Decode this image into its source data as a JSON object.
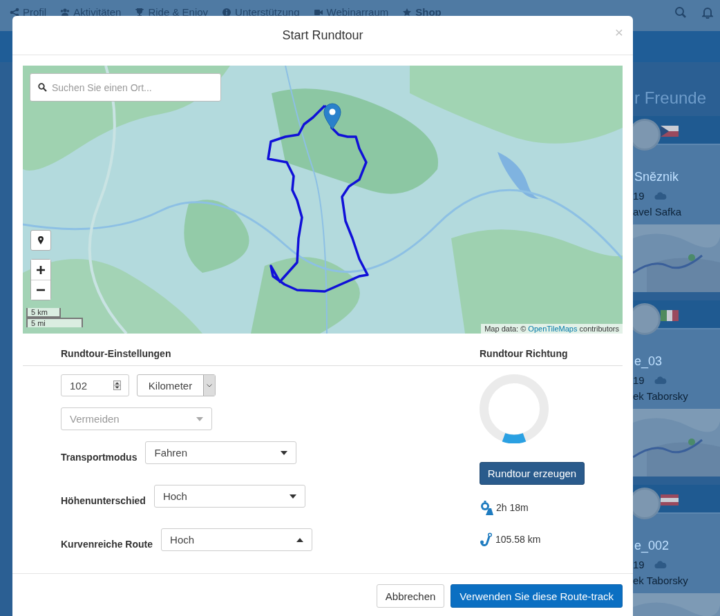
{
  "background_page": {
    "nav": [
      {
        "label": "Profil",
        "highlighted": false
      },
      {
        "label": "Aktivitäten",
        "highlighted": false
      },
      {
        "label": "Ride & Enjoy",
        "highlighted": false
      },
      {
        "label": "Unterstützung",
        "highlighted": false
      },
      {
        "label": "Webinarraum",
        "highlighted": false
      },
      {
        "label": "Shop",
        "highlighted": true
      }
    ],
    "friends_heading": "r Freunde",
    "friend_cards": [
      {
        "title": "Sněznik",
        "date": "19",
        "author": "avel Safka"
      },
      {
        "title": "e_03",
        "date": "19",
        "author": "ek Taborsky"
      },
      {
        "title": "e_002",
        "date": "19",
        "author": "ek Taborsky"
      }
    ]
  },
  "dialog": {
    "title": "Start Rundtour",
    "close": "×",
    "map": {
      "search_placeholder": "Suchen Sie einen Ort...",
      "scale": [
        "5 km",
        "5 mi"
      ],
      "attribution": {
        "prefix": "Map data: ©",
        "link": "OpenTileMaps",
        "suffix": "contributors"
      }
    },
    "settings": {
      "heading": "Rundtour-Einstellungen",
      "distance": "102",
      "unit": "Kilometer",
      "avoid_placeholder": "Vermeiden",
      "fields": [
        {
          "label": "Transportmodus",
          "value": "Fahren",
          "expanded": false
        },
        {
          "label": "Höhenunterschied",
          "value": "Hoch",
          "expanded": false
        },
        {
          "label": "Kurvenreiche Route",
          "value": "Hoch",
          "expanded": true
        }
      ]
    },
    "direction": {
      "heading": "Rundtour Richtung",
      "button": "Rundtour erzeugen",
      "duration": "2h 18m",
      "distance": "105.58 km"
    },
    "buttons": [
      {
        "label": "Abbrechen",
        "kind": "secondary"
      },
      {
        "label": "Verwenden Sie diese Route-track",
        "kind": "primary"
      }
    ]
  }
}
